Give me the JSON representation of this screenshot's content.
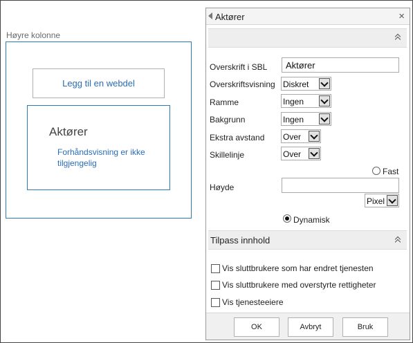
{
  "zone": {
    "title": "Høyre kolonne",
    "add_webpart_label": "Legg til en webdel",
    "webpart_title": "Aktører",
    "webpart_message": "Forhåndsvisning er ikke tilgjengelig"
  },
  "pane": {
    "title": "Aktører",
    "close_glyph": "×",
    "fields": {
      "title_label": "Overskrift i SBL",
      "title_value": "Aktører",
      "title_display_label": "Overskriftsvisning",
      "title_display_value": "Diskret",
      "frame_label": "Ramme",
      "frame_value": "Ingen",
      "background_label": "Bakgrunn",
      "background_value": "Ingen",
      "extra_spacing_label": "Ekstra avstand",
      "extra_spacing_value": "Over",
      "divider_label": "Skillelinje",
      "divider_value": "Over",
      "height_label": "Høyde",
      "height_value": "",
      "height_fixed_label": "Fast",
      "height_unit_value": "Pixel",
      "height_dynamic_label": "Dynamisk"
    },
    "section_content": {
      "title": "Tilpass innhold",
      "checkboxes": [
        {
          "label": "Vis sluttbrukere som har endret tjenesten",
          "checked": false
        },
        {
          "label": "Vis sluttbrukere med overstyrte rettigheter",
          "checked": false
        },
        {
          "label": "Vis tjenesteeiere",
          "checked": false
        }
      ]
    },
    "buttons": {
      "ok": "OK",
      "cancel": "Avbryt",
      "apply": "Bruk"
    }
  },
  "colors": {
    "accent_blue": "#2b79b5",
    "link_blue": "#2a6cb5"
  }
}
